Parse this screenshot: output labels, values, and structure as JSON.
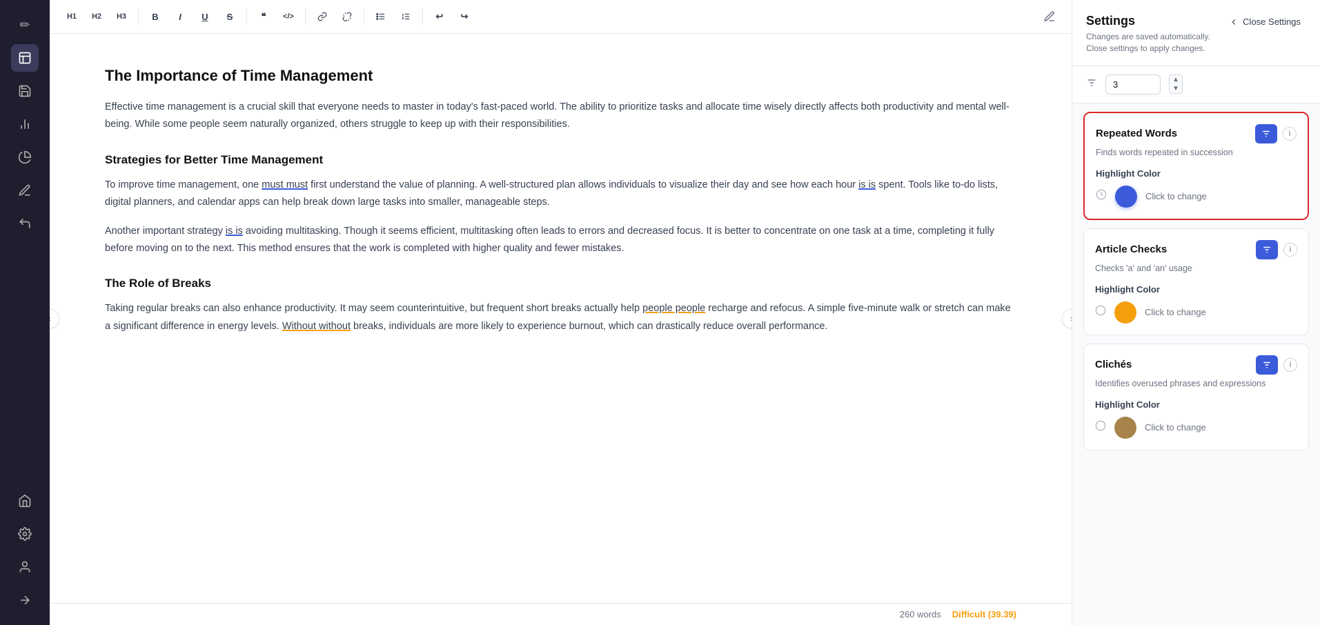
{
  "sidebar": {
    "icons": [
      {
        "name": "edit-icon",
        "symbol": "✏️",
        "active": false
      },
      {
        "name": "document-icon",
        "symbol": "📄",
        "active": true
      },
      {
        "name": "save-icon",
        "symbol": "💾",
        "active": false
      },
      {
        "name": "chart-icon",
        "symbol": "📊",
        "active": false
      },
      {
        "name": "pie-icon",
        "symbol": "🥧",
        "active": false
      },
      {
        "name": "highlight-icon",
        "symbol": "🖊",
        "active": false
      },
      {
        "name": "undo-icon",
        "symbol": "↩",
        "active": false
      },
      {
        "name": "home-icon",
        "symbol": "🏠",
        "active": false
      },
      {
        "name": "settings-icon",
        "symbol": "⚙️",
        "active": false
      },
      {
        "name": "user-icon",
        "symbol": "👤",
        "active": false
      },
      {
        "name": "arrow-icon",
        "symbol": "→",
        "active": false
      }
    ]
  },
  "toolbar": {
    "buttons": [
      {
        "name": "h1-btn",
        "label": "H1"
      },
      {
        "name": "h2-btn",
        "label": "H2"
      },
      {
        "name": "h3-btn",
        "label": "H3"
      },
      {
        "name": "bold-btn",
        "label": "B"
      },
      {
        "name": "italic-btn",
        "label": "I"
      },
      {
        "name": "underline-btn",
        "label": "U"
      },
      {
        "name": "strikethrough-btn",
        "label": "S"
      },
      {
        "name": "quote-btn",
        "label": "❝"
      },
      {
        "name": "code-btn",
        "label": "<>"
      },
      {
        "name": "link-btn",
        "label": "🔗"
      },
      {
        "name": "unlink-btn",
        "label": "⛓️‍💥"
      },
      {
        "name": "bullet-btn",
        "label": "☰"
      },
      {
        "name": "numbered-btn",
        "label": "≡"
      },
      {
        "name": "undo-btn",
        "label": "↩"
      },
      {
        "name": "redo-btn",
        "label": "↪"
      }
    ],
    "edit_icon_label": "✏"
  },
  "editor": {
    "title": "The Importance of Time Management",
    "paragraphs": [
      "Effective time management is a crucial skill that everyone needs to master in today's fast-paced world. The ability to prioritize tasks and allocate time wisely directly affects both productivity and mental well-being. While some people seem naturally organized, others struggle to keep up with their responsibilities.",
      "To improve time management, one {must must} first understand the value of planning. A well-structured plan allows individuals to visualize their day and see how each hour {is is} spent. Tools like to-do lists, digital planners, and calendar apps can help break down large tasks into smaller, manageable steps.",
      "Another important strategy {is is} avoiding multitasking. Though it seems efficient, multitasking often leads to errors and decreased focus. It is better to concentrate on one task at a time, completing it fully before moving on to the next. This method ensures that the work is completed with higher quality and fewer mistakes."
    ],
    "heading2_1": "Strategies for Better Time Management",
    "heading2_2": "The Role of Breaks",
    "breaks_paragraph": "Taking regular breaks can also enhance productivity. It may seem counterintuitive, but frequent short breaks actually help {people people} recharge and refocus. A simple five-minute walk or stretch can make a significant difference in energy levels. {Without without} breaks, individuals are more likely to experience burnout, which can drastically reduce overall performance."
  },
  "status": {
    "word_count": "260 words",
    "difficulty_label": "Difficult",
    "difficulty_score": "(39.39)"
  },
  "settings": {
    "title": "Settings",
    "description": "Changes are saved automatically. Close settings to apply changes.",
    "close_button_label": "Close Settings",
    "filter_value": "3",
    "checks": [
      {
        "id": "repeated-words",
        "title": "Repeated Words",
        "description": "Finds words repeated in succession",
        "highlighted": true,
        "color": "#3b5bdb",
        "color_label": "Click to change",
        "highlight_color_label": "Highlight Color"
      },
      {
        "id": "article-checks",
        "title": "Article Checks",
        "description": "Checks 'a' and 'an' usage",
        "highlighted": false,
        "color": "#f59e0b",
        "color_label": "Click to change",
        "highlight_color_label": "Highlight Color"
      },
      {
        "id": "cliches",
        "title": "Clichés",
        "description": "Identifies overused phrases and expressions",
        "highlighted": false,
        "color": "#a8844a",
        "color_label": "Click to change",
        "highlight_color_label": "Highlight Color"
      }
    ]
  }
}
